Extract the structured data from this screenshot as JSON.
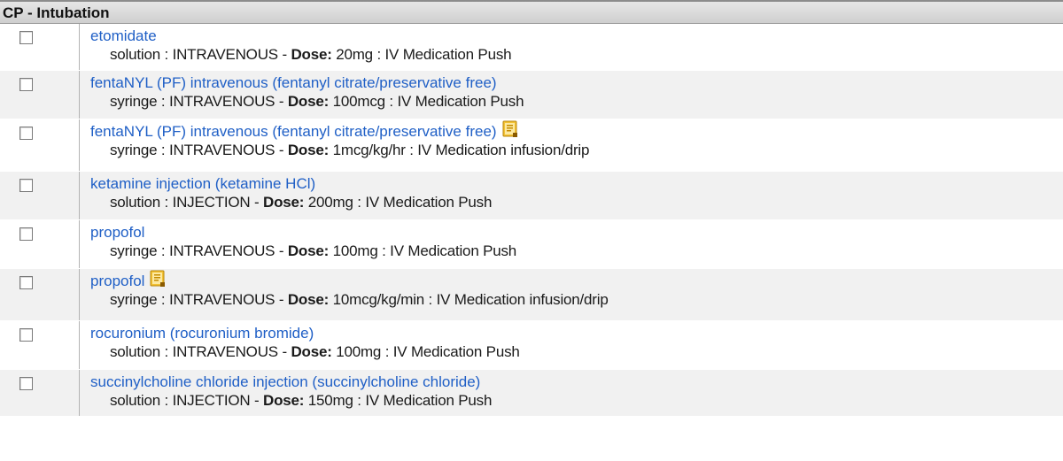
{
  "section": {
    "title": "CP - Intubation"
  },
  "orders": [
    {
      "name": "etomidate",
      "form": "solution",
      "route": "INTRAVENOUS",
      "dose_label": "Dose:",
      "dose": "20mg",
      "admin": "IV Medication Push",
      "has_note": false
    },
    {
      "name": "fentaNYL (PF) intravenous (fentanyl citrate/preservative free)",
      "form": "syringe",
      "route": "INTRAVENOUS",
      "dose_label": "Dose:",
      "dose": "100mcg",
      "admin": "IV Medication Push",
      "has_note": false
    },
    {
      "name": "fentaNYL (PF) intravenous (fentanyl citrate/preservative free)",
      "form": "syringe",
      "route": "INTRAVENOUS",
      "dose_label": "Dose:",
      "dose": "1mcg/kg/hr",
      "admin": "IV Medication infusion/drip",
      "has_note": true
    },
    {
      "name": "ketamine injection (ketamine HCl)",
      "form": "solution",
      "route": "INJECTION",
      "dose_label": "Dose:",
      "dose": "200mg",
      "admin": "IV Medication Push",
      "has_note": false
    },
    {
      "name": "propofol",
      "form": "syringe",
      "route": "INTRAVENOUS",
      "dose_label": "Dose:",
      "dose": "100mg",
      "admin": "IV Medication Push",
      "has_note": false
    },
    {
      "name": "propofol",
      "form": "syringe",
      "route": "INTRAVENOUS",
      "dose_label": "Dose:",
      "dose": "10mcg/kg/min",
      "admin": "IV Medication infusion/drip",
      "has_note": true
    },
    {
      "name": "rocuronium (rocuronium bromide)",
      "form": "solution",
      "route": "INTRAVENOUS",
      "dose_label": "Dose:",
      "dose": "100mg",
      "admin": "IV Medication Push",
      "has_note": false
    },
    {
      "name": "succinylcholine chloride injection (succinylcholine chloride)",
      "form": "solution",
      "route": "INJECTION",
      "dose_label": "Dose:",
      "dose": "150mg",
      "admin": "IV Medication Push",
      "has_note": false
    }
  ],
  "colors": {
    "link": "#1f5fc6",
    "row_alt": "#f1f1f1",
    "header_bg": "#d9d9d9"
  },
  "icons": {
    "note": "order-note-icon"
  }
}
